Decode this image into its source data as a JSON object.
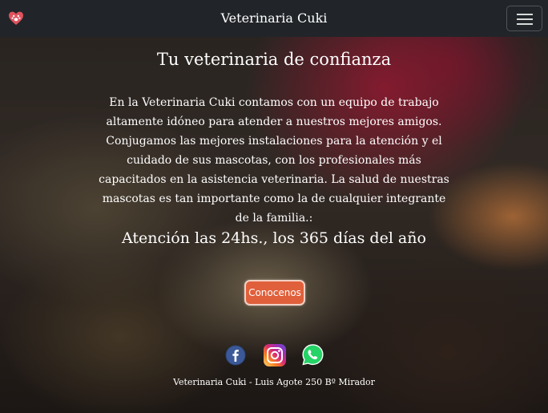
{
  "navbar": {
    "brand": "Veterinaria Cuki",
    "logo_icon": "paw-heart-icon",
    "menu_icon": "hamburger-menu-icon"
  },
  "hero": {
    "title": "Tu veterinaria de confianza",
    "description": "En la Veterinaria Cuki contamos con un equipo de trabajo altamente idóneo para atender a nuestros mejores amigos. Conjugamos las mejores instalaciones para la atención y el cuidado de sus mascotas, con los profesionales más capacitados en la asistencia veterinaria. La salud de nuestras mascotas es tan importante como la de cualquier integrante de la familia.:",
    "hours": "Atención las 24hs., los 365 días del año",
    "cta_label": "Conocenos"
  },
  "social": [
    {
      "name": "facebook-icon"
    },
    {
      "name": "instagram-icon"
    },
    {
      "name": "whatsapp-icon"
    }
  ],
  "footer": {
    "text": "Veterinaria Cuki - Luis Agote 250 Bº Mirador"
  },
  "colors": {
    "navbar": "#212529",
    "accent": "#e0603b",
    "logo": "#e0525e"
  }
}
